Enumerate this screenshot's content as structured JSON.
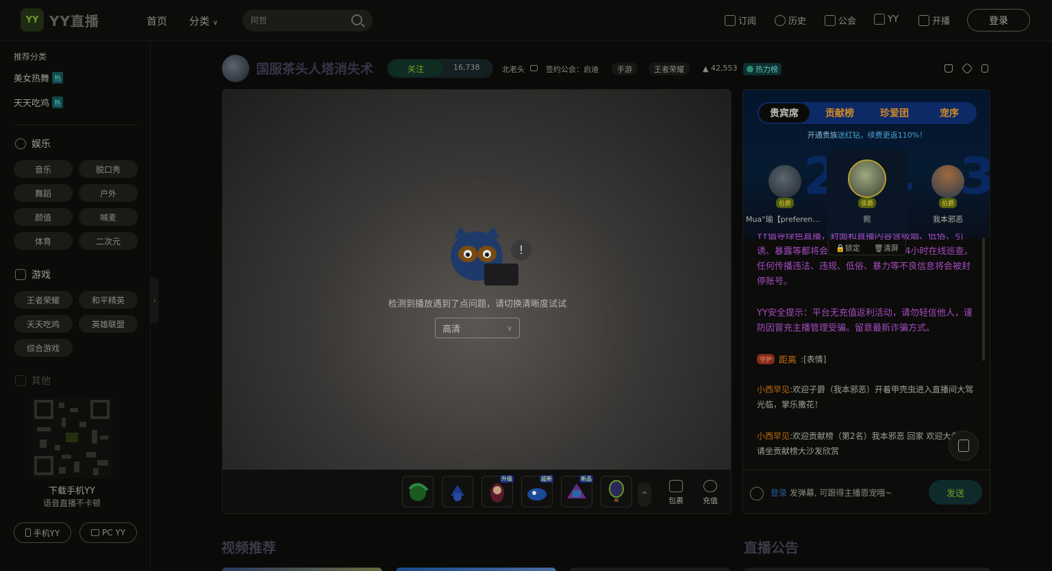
{
  "app": {
    "logo_badge": "YY",
    "logo_text": "YY直播"
  },
  "topnav": {
    "home": "首页",
    "category": "分类",
    "search_placeholder": "阿哲",
    "subscribe": "订阅",
    "history": "历史",
    "guild": "公会",
    "yy": "YY",
    "broadcast": "开播",
    "login": "登录"
  },
  "sidebar": {
    "recommended_title": "推荐分类",
    "hot_items": [
      {
        "label": "美女热舞",
        "tag": "热"
      },
      {
        "label": "天天吃鸡",
        "tag": "热"
      }
    ],
    "entertainment": {
      "title": "娱乐",
      "items": [
        "音乐",
        "脱口秀",
        "舞蹈",
        "户外",
        "颜值",
        "喊麦",
        "体育",
        "二次元"
      ]
    },
    "games": {
      "title": "游戏",
      "items": [
        "王者荣耀",
        "和平精英",
        "天天吃鸡",
        "英雄联盟",
        "综合游戏"
      ]
    },
    "other_title": "其他",
    "qr_caption": "下载手机YY",
    "qr_subcaption": "语音直播不卡顿",
    "mobile_yy": "手机YY",
    "pc_yy": "PC YY",
    "collapse": "‹"
  },
  "room": {
    "title": "国服茶头人塔消失术",
    "follow_label": "关注",
    "follow_count": "16,738",
    "host": "北老头",
    "guild_label": "签约公会：启迪",
    "tags": [
      "手游",
      "王者荣耀"
    ],
    "heat": "42,553",
    "hot_rank": "热力榜"
  },
  "player": {
    "error_text": "检测到播放遇到了点问题，请切换清晰度试试",
    "quality": "高清",
    "gifts_badges": [
      "升级",
      "超新",
      "新品"
    ],
    "package_label": "包裹",
    "recharge_label": "充值",
    "expand_label": "^"
  },
  "panel": {
    "tabs": [
      "贵宾席",
      "贡献榜",
      "珍爱团",
      "宠序"
    ],
    "promo_prefix": "开通贵族",
    "promo_text": "送红钻，续费更返110%！",
    "ranks": [
      {
        "rank": "2",
        "name": "Mua°瑜【preference】",
        "badge": "伯爵"
      },
      {
        "rank": "1",
        "name": "熙",
        "badge": "侯爵"
      },
      {
        "rank": "3",
        "name": "我本邪恶",
        "badge": "伯爵"
      }
    ],
    "lock_label": "锁定",
    "clear_label": "清屏",
    "chat": {
      "sys_msg": "YY倡导绿色直播，封面和直播内容含吸烟、低俗、引诱、暴露等都将会被封停账号，网警24小时在线巡查。任何传播违法、违规、低俗、暴力等不良信息将会被封停账号。",
      "warn_msg": "YY安全提示：平台无充值返利活动，请勿轻信他人，谨防因冒充主播管理受骗。留意最新诈骗方式。",
      "gift_tag": "守护",
      "gift_user": "距离",
      "gift_text": ":[表情]",
      "msg1_user": "小西早见",
      "msg1_text": ":欢迎子爵（我本邪恶）开着甲壳虫进入直播间大驾光临，掌乐撒花！",
      "msg2_user": "小西早见",
      "msg2_text": ":欢迎贡献榜（第2名）我本邪恶 回家 欢迎大老板，请坐贡献榜大沙发欣赏"
    },
    "input_login": "登录",
    "input_placeholder": "发弹幕, 可跟得主播恩宠哦~",
    "send_label": "发送"
  },
  "sections": {
    "video_recommend": "视频推荐",
    "announcement": "直播公告"
  }
}
